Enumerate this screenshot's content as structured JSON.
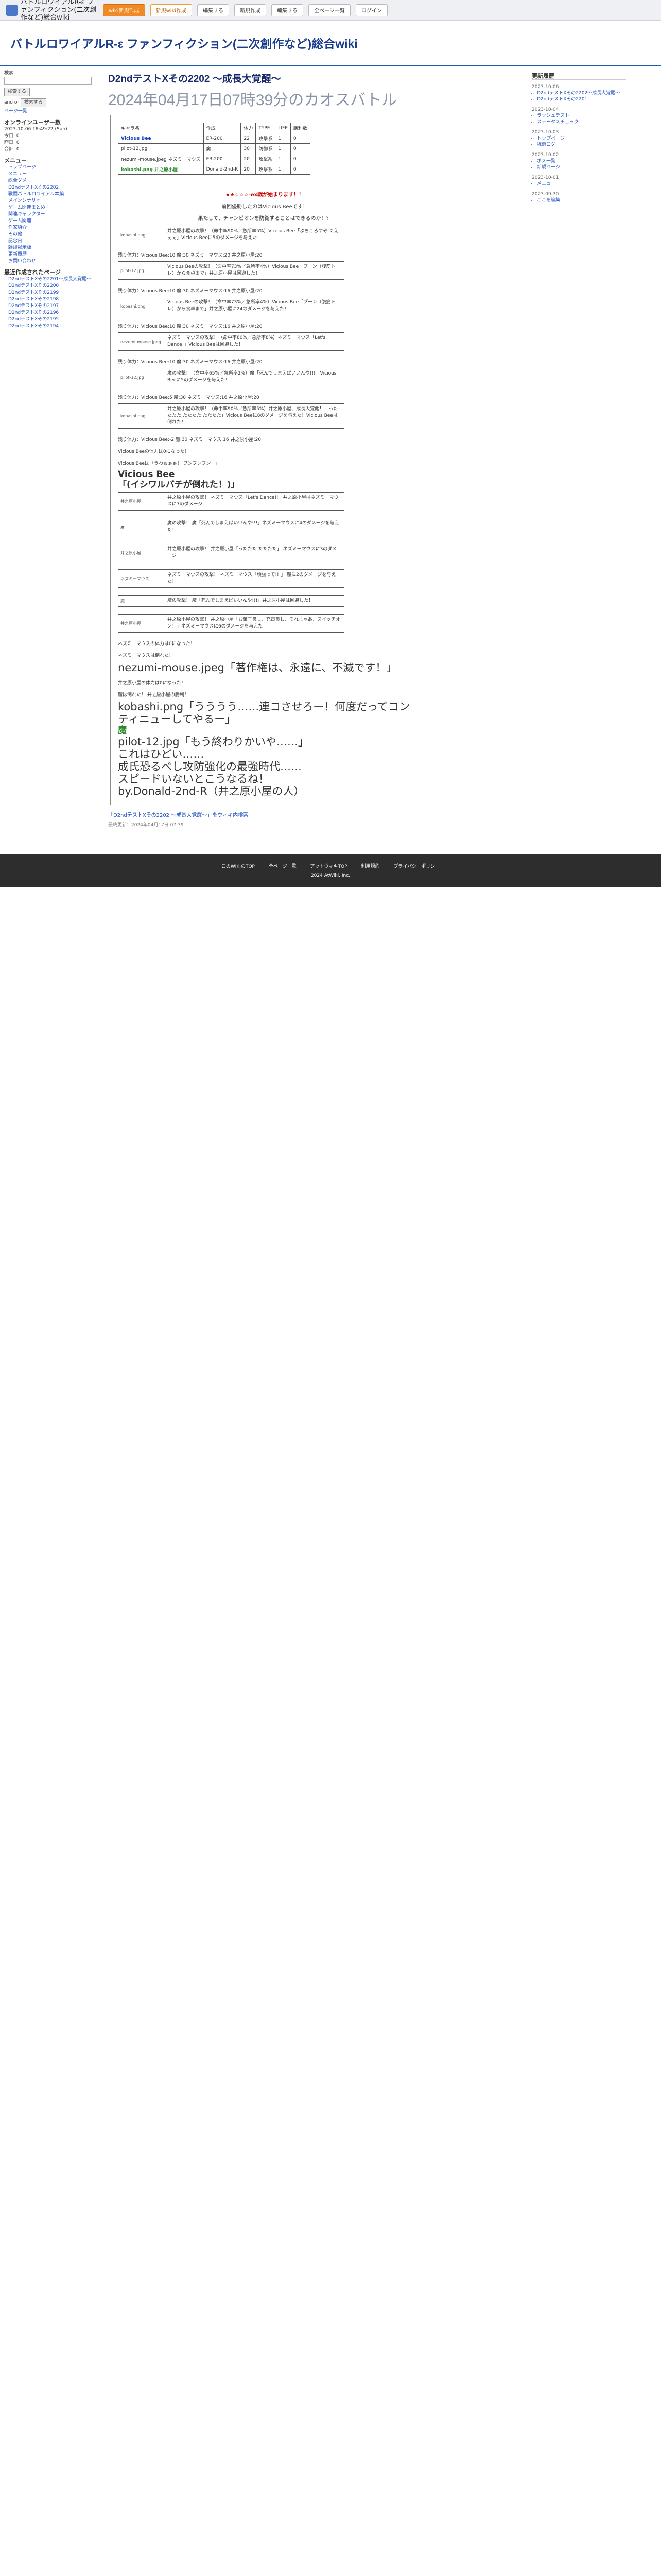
{
  "topbar": {
    "brand": "バトルロワイアルR-ε ファンフィクション(二次創作など)総合wiki",
    "btn_new": "wiki新規作成",
    "btn_login": "新規wiki作成",
    "btn_edit": "編集する",
    "btn_newpage": "新規作成",
    "btn_edit2": "編集する",
    "btn_pages": "全ページ一覧",
    "btn_log": "ログイン"
  },
  "wiki_title": "バトルロワイアルR-ε ファンフィクション(二次創作など)総合wiki",
  "left": {
    "search_label": "検索",
    "search_btn": "検索する",
    "and": "and",
    "or": "or",
    "search_btn2": "検索する",
    "back": "ページ一覧",
    "online": "オンラインユーザー数",
    "date": "2023-10-06 18:49:22 (Sun)",
    "today": "今日: 0",
    "yesterday": "昨日: 0",
    "total": "合計: 0",
    "menu": "メニュー",
    "items": [
      "トップページ",
      "メニュー",
      "総合ダメ",
      "D2ndテストXその2202",
      "戦闘バトルロワイアル本編",
      "メインシナリオ",
      "ゲーム関連まとめ",
      "関連キャラクター",
      "ゲーム関連",
      "作家紹介",
      "その他",
      "記念日",
      "雑談掲示板",
      "更新履歴",
      "お問い合わせ"
    ],
    "recent_title": "最近作成されたページ",
    "recent": [
      "D2ndテストXその2201〜成長大覚醒〜",
      "D2ndテストXその2200",
      "D2ndテストXその2199",
      "D2ndテストXその2198",
      "D2ndテストXその2197",
      "D2ndテストXその2196",
      "D2ndテストXその2195",
      "D2ndテストXその2194"
    ]
  },
  "right": {
    "title": "更新履歴",
    "dates": [
      "2023-10-06",
      "2023-10-04",
      "2023-10-03",
      "2023-10-02",
      "2023-10-01",
      "2023-09-30"
    ],
    "items": [
      "D2ndテストXその2202〜成長大覚醒〜",
      "D2ndテストXその2201",
      "ラッシュテスト",
      "ステータスチェック",
      "トップページ",
      "戦闘ログ",
      "ボス一覧",
      "新規ページ",
      "メニュー",
      "ここを編集"
    ]
  },
  "main": {
    "h2": "D2ndテストXその2202 〜成長大覚醒〜",
    "subtitle": "2024年04月17日07時39分のカオスバトル",
    "crumb": "「D2ndテストXその2202 〜成長大覚醒〜」をウィキ内検索",
    "meta": "最終更新：2024年04月17日 07:39"
  },
  "table": {
    "header": [
      "キャラ名",
      "作成",
      "体力",
      "TYPE",
      "LIFE",
      "勝利数"
    ],
    "rows": [
      [
        "Vicious Bee",
        "ER-200",
        "22",
        "攻撃系",
        "1",
        "0"
      ],
      [
        "pilot-12.jpg",
        "魔",
        "30",
        "防御系",
        "1",
        "0"
      ],
      [
        "nezumi-mouse.jpeg ネズミーマウス",
        "ER-200",
        "20",
        "攻撃系",
        "1",
        "0"
      ],
      [
        "kobashi.png 井之原小屋",
        "Donald-2nd-R",
        "20",
        "攻撃系",
        "1",
        "0"
      ]
    ]
  },
  "intro": {
    "l1": "★★☆☆☆-ex戦が始まります！！",
    "l2": "前回優勝したのはVicious Beeです！",
    "l3": "果たして、チャンピオンを防衛することはできるのか！？"
  },
  "boxes": [
    {
      "img": "kobashi.png",
      "text": "井之原小屋の攻撃！（命中率90%／急所率5%）Vicious Bee「ぶちころすぞ ぐえぇぇ」Vicious Beeに5のダメージを与えた！"
    },
    {
      "img": "pilot-12.jpg",
      "text": "Vicious Beeの攻撃！（命中率73%／急所率4%）Vicious Bee「ブーン（腹筋トレ）から食卓まで」井之原小屋は回避した！"
    },
    {
      "img": "kobashi.png",
      "text": "Vicious Beeの攻撃！（命中率73%／急所率4%）Vicious Bee「ブーン（腹筋トレ）から食卓まで」井之原小屋に24のダメージを与えた！"
    },
    {
      "img": "nezumi-mouse.jpeg",
      "text": "ネズミーマウスの攻撃！（命中率80%／急所率8%）ネズミーマウス「Let's Dance!」Vicious Beeは回避した！"
    },
    {
      "img": "pilot-12.jpg",
      "text": "魔の攻撃！（命中率65%／急所率2%）魔「死んでしまえばいいんや!!!」Vicious Beeに5のダメージを与えた！"
    },
    {
      "img": "kobashi.png",
      "text": "井之原小屋の攻撃！（命中率90%／急所率5%）井之原小屋、成長大覚醒！「ったたたた たたたた たたたた」Vicious Beeに8のダメージを与えた！Vicious Beeは倒れた！"
    }
  ],
  "lines": [
    "残り体力：Vicious Bee:10 魔:30 ネズミーマウス:20 井之原小屋:20",
    "残り体力：Vicious Bee:10 魔:30 ネズミーマウス:16 井之原小屋:20",
    "残り体力：Vicious Bee:10 魔:30 ネズミーマウス:16 井之原小屋:20",
    "残り体力：Vicious Bee:10 魔:30 ネズミーマウス:16 井之原小屋:20",
    "残り体力：Vicious Bee:5 魔:30 ネズミーマウス:16 井之原小屋:20",
    "残り体力：Vicious Bee:-2 魔:30 ネズミーマウス:16 井之原小屋:20"
  ],
  "defeat": {
    "l1": "Vicious Beeの体力は0になった！",
    "l2": "Vicious Beeは「うわぁぁぁ！ ブンブンブン！」",
    "big": "Vicious Bee",
    "quote": "「(イシワルバチが倒れた！)」"
  },
  "rounds": [
    {
      "who": "井之原小屋",
      "text": "井之原小屋の攻撃！ ネズミーマウス「Let's Dance!!」井之原小屋はネズミーマウスに7のダメージ"
    },
    {
      "who": "魔",
      "text": "魔の攻撃！ 魔「死んでしまえばいいんや!!!」ネズミーマウスに4のダメージを与えた！"
    },
    {
      "who": "井之原小屋",
      "text": "井之原小屋の攻撃！ 井之原小屋「ったたた たたたた」 ネズミーマウスに3のダメージ"
    },
    {
      "who": "ネズミーマウス",
      "text": "ネズミーマウスの攻撃！ ネズミーマウス「頑張って!!!」 魔に2のダメージを与えた！"
    },
    {
      "who": "魔",
      "text": "魔の攻撃！ 魔「死んでしまえばいいんや!!!」井之原小屋は回避した！"
    },
    {
      "who": "井之原小屋",
      "text": "井之原小屋の攻撃！ 井之原小屋「お菓子良し、充電良し、それじゃあ、スイッチオン！」ネズミーマウスに6のダメージを与えた！"
    }
  ],
  "finale": {
    "l1": "ネズミーマウスの体力は0になった！",
    "l2": "ネズミーマウスは倒れた！",
    "mouse": "nezumi-mouse.jpeg「著作権は、永遠に、不滅です！」",
    "end1": "井之原小屋の体力は0になった！",
    "end2": "魔は倒れた！ 井之原小屋の勝利！",
    "quote1": "kobashi.png「うううう……連コさせろー！何度だってコンティニューしてやるー」",
    "winner": "魔",
    "quote2": "pilot-12.jpg「もう終わりかいや……」",
    "c1": "これはひどい……",
    "c2": "成氏恐るべし攻防強化の最強時代……",
    "c3": "スピードいないとこうなるね！",
    "c4": "by.Donald-2nd-R（井之原小屋の人）"
  },
  "footer": {
    "links": [
      "このWIKIのTOP",
      "全ページ一覧",
      "アットウィキTOP",
      "利用規約",
      "プライバシーポリシー"
    ],
    "copy": "2024 AtWiki, Inc."
  }
}
